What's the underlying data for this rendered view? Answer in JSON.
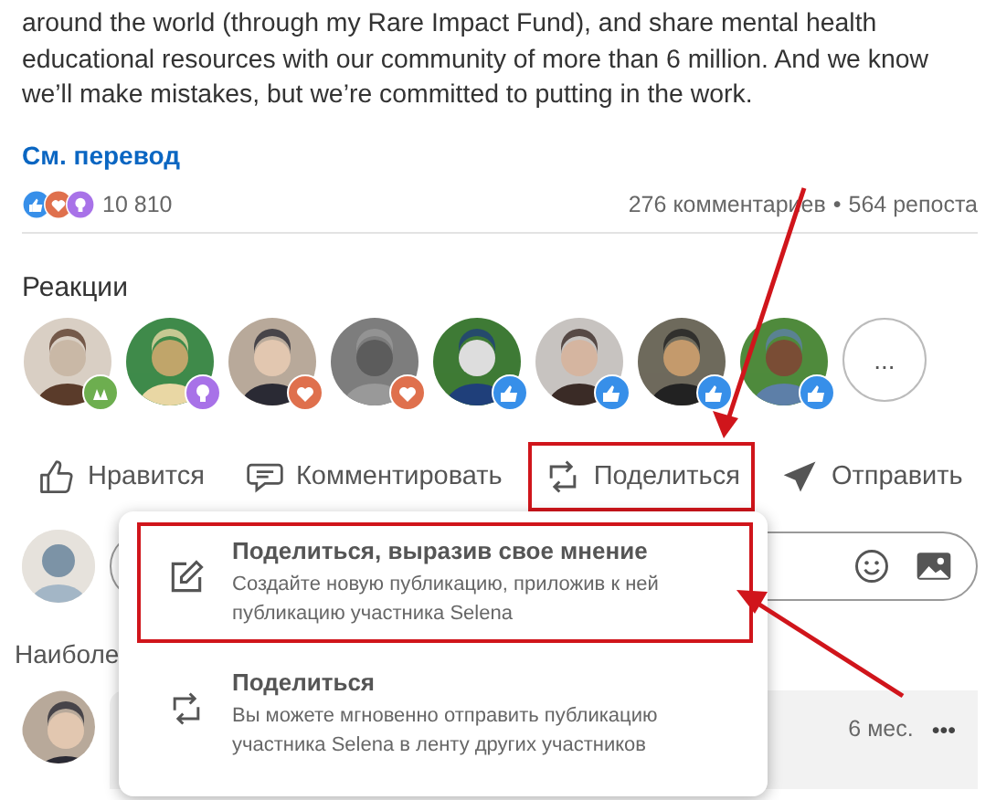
{
  "post": {
    "body": "around the world (through my Rare Impact Fund), and share mental health educational resources with our community of more than 6 million. And we know we’ll make mistakes, but we’re committed to putting in the work.",
    "translate_link": "См. перевод"
  },
  "social_counts": {
    "reaction_icons": [
      {
        "kind": "like"
      },
      {
        "kind": "love"
      },
      {
        "kind": "curious"
      }
    ],
    "reactions_count": "10 810",
    "comments": "276 комментариев",
    "separator": "•",
    "reposts": "564 репоста"
  },
  "reactions": {
    "title": "Реакции",
    "people": [
      {
        "badge": {
          "kind": "support"
        }
      },
      {
        "badge": {
          "kind": "curious"
        }
      },
      {
        "badge": {
          "kind": "love"
        }
      },
      {
        "badge": {
          "kind": "love"
        }
      },
      {
        "badge": {
          "kind": "like"
        }
      },
      {
        "badge": {
          "kind": "like"
        }
      },
      {
        "badge": {
          "kind": "like"
        }
      },
      {
        "badge": {
          "kind": "like"
        }
      }
    ],
    "more": "..."
  },
  "actions": [
    {
      "kind": "like",
      "label": "Нравится",
      "highlighted": false
    },
    {
      "kind": "comment",
      "label": "Комментировать",
      "highlighted": false
    },
    {
      "kind": "repost",
      "label": "Поделиться",
      "highlighted": true
    },
    {
      "kind": "send",
      "label": "Отправить",
      "highlighted": false
    }
  ],
  "sort_label": "Наиболе",
  "comment": {
    "time": "6 мес.",
    "menu": "•••"
  },
  "share_menu": {
    "items": [
      {
        "kind": "edit",
        "title": "Поделиться, выразив свое мнение",
        "description": "Создайте новую публикацию, приложив к ней публикацию участника Selena",
        "highlighted": true
      },
      {
        "kind": "repost",
        "title": "Поделиться",
        "description": "Вы можете мгновенно отправить публикацию участника Selena в ленту других участников",
        "highlighted": false
      }
    ]
  }
}
